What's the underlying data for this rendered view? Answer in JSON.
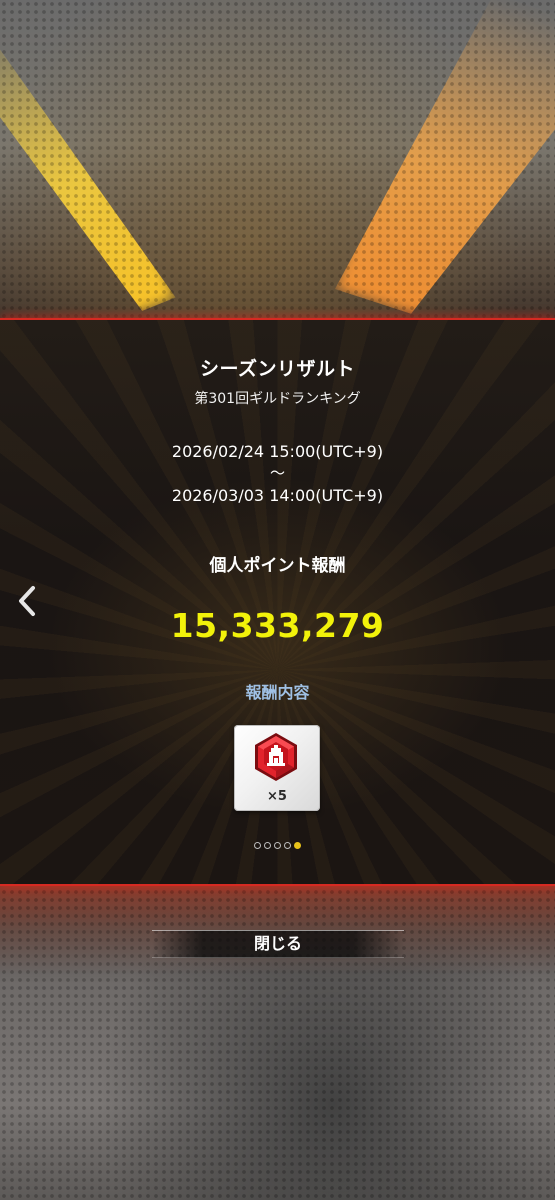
{
  "result": {
    "title": "シーズンリザルト",
    "subtitle": "第301回ギルドランキング",
    "period_start": "2026/02/24 15:00(UTC+9)",
    "period_separator": "～",
    "period_end": "2026/03/03 14:00(UTC+9)",
    "points_label": "個人ポイント報酬",
    "points_value": "15,333,279",
    "rewards_label": "報酬内容",
    "reward_item": {
      "icon": "red-hexagon-gem-icon",
      "quantity": "×5"
    },
    "pager": {
      "total": 5,
      "current": 5
    }
  },
  "navigation": {
    "back_icon": "chevron-left-icon",
    "close_label": "閉じる"
  },
  "colors": {
    "accent_red": "#d62a22",
    "points_yellow": "#f2f20a",
    "rewards_blue": "#9fc0e4",
    "pager_active": "#e8c21a"
  }
}
